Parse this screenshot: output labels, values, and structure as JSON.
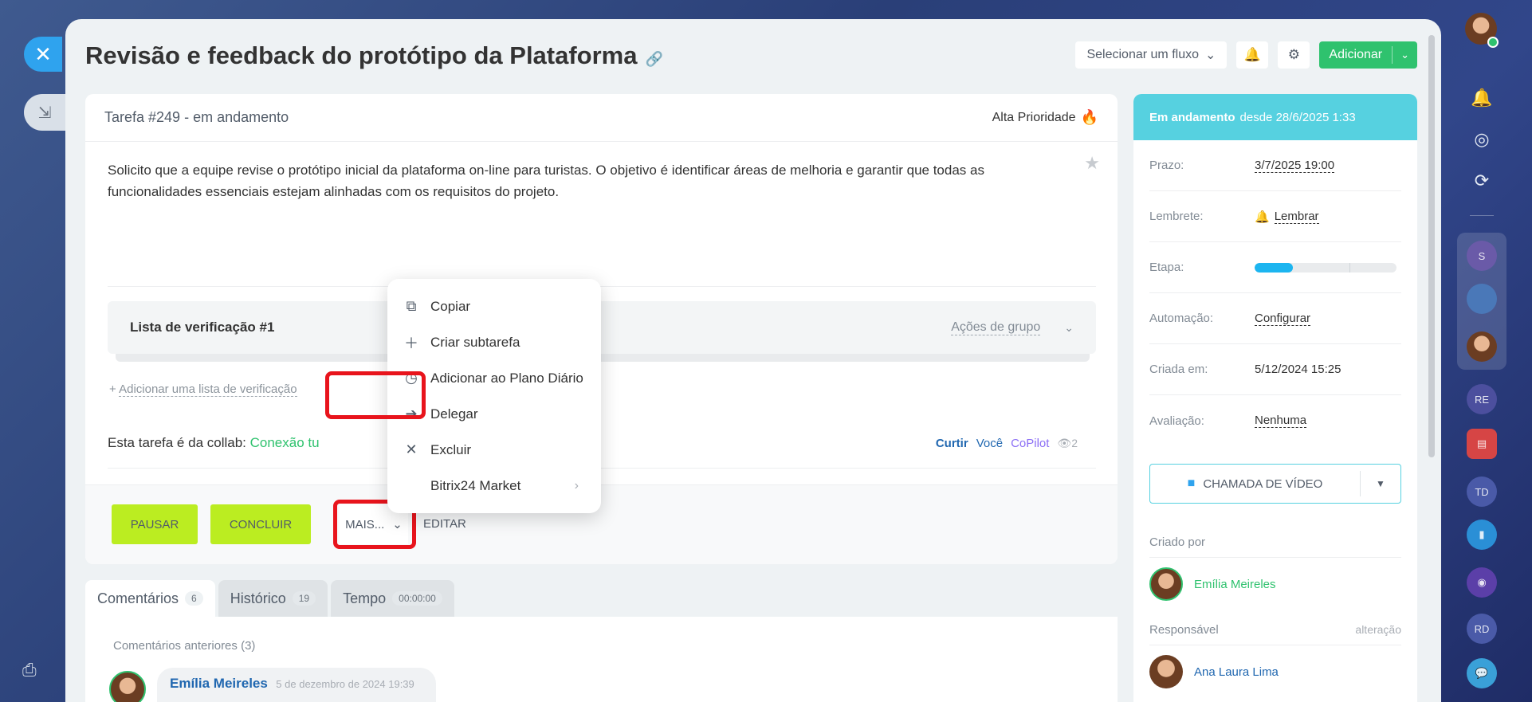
{
  "page": {
    "title": "Revisão e feedback do protótipo da Plataforma"
  },
  "top_actions": {
    "flow_select": "Selecionar um fluxo",
    "add_label": "Adicionar"
  },
  "task": {
    "id_status": "Tarefa #249 - em andamento",
    "priority": "Alta Prioridade",
    "description": "Solicito que a equipe revise o protótipo inicial da plataforma on-line para turistas. O objetivo é identificar áreas de melhoria e garantir que todas as funcionalidades essenciais estejam alinhadas com os requisitos do projeto.",
    "checklist_title": "Lista de verificação #1",
    "group_actions": "Ações de grupo",
    "add_checklist_prefix": "+",
    "add_checklist": "Adicionar uma lista de verificação",
    "collab_prefix": "Esta tarefa é da collab:",
    "collab_name": "Conexão tu",
    "like": "Curtir",
    "you": "Você",
    "copilot": "CoPilot",
    "views": "2"
  },
  "buttons": {
    "pause": "PAUSAR",
    "finish": "CONCLUIR",
    "more": "MAIS...",
    "edit": "EDITAR"
  },
  "menu": {
    "items": [
      {
        "label": "Copiar",
        "icon": "copy-icon"
      },
      {
        "label": "Criar subtarefa",
        "icon": "plus-icon"
      },
      {
        "label": "Adicionar ao Plano Diário",
        "icon": "clock-icon"
      },
      {
        "label": "Delegar",
        "icon": "delegate-icon"
      },
      {
        "label": "Excluir",
        "icon": "close-icon"
      },
      {
        "label": "Bitrix24 Market",
        "icon": ""
      }
    ]
  },
  "tabs": [
    {
      "label": "Comentários",
      "count": "6"
    },
    {
      "label": "Histórico",
      "count": "19"
    },
    {
      "label": "Tempo",
      "count": "00:00:00"
    }
  ],
  "comments": {
    "previous": "Comentários anteriores (3)",
    "author": "Emília Meireles",
    "date": "5 de dezembro de 2024 19:39"
  },
  "sidebar": {
    "status_bold": "Em andamento",
    "status_rest": "desde 28/6/2025 1:33",
    "rows": [
      {
        "key": "Prazo:",
        "value": "3/7/2025 19:00"
      },
      {
        "key": "Lembrete:",
        "value": "Lembrar"
      },
      {
        "key": "Etapa:",
        "value": ""
      },
      {
        "key": "Automação:",
        "value": "Configurar"
      },
      {
        "key": "Criada em:",
        "value": "5/12/2024 15:25"
      },
      {
        "key": "Avaliação:",
        "value": "Nenhuma"
      }
    ],
    "stage_progress": 0.27,
    "video_call": "CHAMADA DE VÍDEO",
    "created_by_label": "Criado por",
    "created_by": "Emília Meireles",
    "responsible_label": "Responsável",
    "change_label": "alteração",
    "responsible": "Ana Laura Lima"
  },
  "rail": {
    "circles": [
      "S",
      "RE",
      "TD",
      "RD"
    ]
  },
  "colors": {
    "accent_green": "#2fc26e",
    "button_lime": "#bbed21",
    "status_cyan": "#56d1e0",
    "highlight_red": "#e8141c"
  }
}
